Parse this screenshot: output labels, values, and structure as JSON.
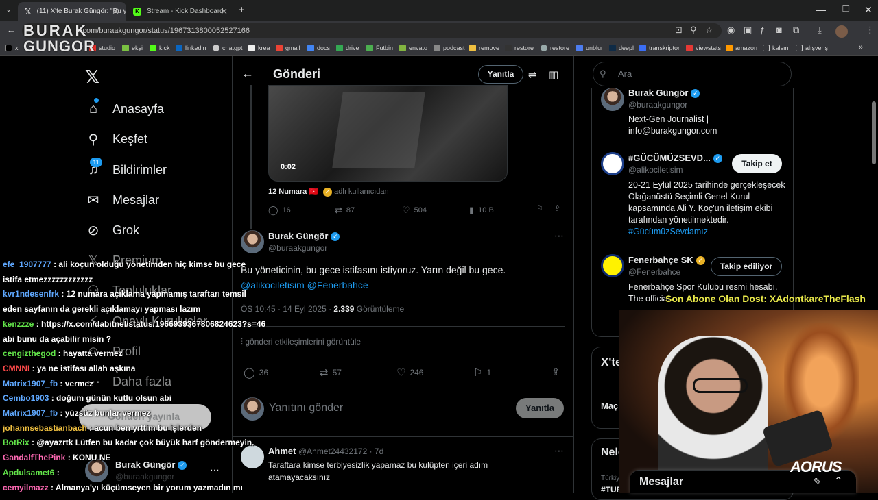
{
  "browser": {
    "tabs": [
      {
        "title": "(11) X'te Burak Güngör: \"Bu yön",
        "icon": "x-icon"
      },
      {
        "title": "Stream - Kick Dashboard",
        "icon": "kick-icon"
      }
    ],
    "url": "x.com/buraakgungor/status/1967313800052527166",
    "bookmarks": [
      "x",
      "studio",
      "ekşi",
      "kick",
      "linkedin",
      "chatgpt",
      "krea",
      "gmail",
      "docs",
      "drive",
      "Futbin",
      "envato",
      "podcast",
      "remove",
      "restore",
      "restore",
      "unblur",
      "deepl",
      "transkriptor",
      "viewstats",
      "amazon",
      "kalsın",
      "alışveriş"
    ]
  },
  "overlay_logo": {
    "line1": "BURAK",
    "line2": "GUNGOR"
  },
  "nav": {
    "items": [
      {
        "label": "Anasayfa",
        "icon": "home-icon"
      },
      {
        "label": "Keşfet",
        "icon": "search-icon"
      },
      {
        "label": "Bildirimler",
        "icon": "bell-icon"
      },
      {
        "label": "Mesajlar",
        "icon": "mail-icon"
      },
      {
        "label": "Grok",
        "icon": "grok-icon"
      },
      {
        "label": "Premium",
        "icon": "x-premium-icon"
      },
      {
        "label": "Topluluklar",
        "icon": "communities-icon"
      },
      {
        "label": "Onaylı Kuruluşlar",
        "icon": "verified-orgs-icon"
      },
      {
        "label": "Profil",
        "icon": "profile-icon"
      },
      {
        "label": "Daha fazla",
        "icon": "more-icon"
      }
    ],
    "notif_count": "11",
    "post_button": "Gönderi yayınla",
    "account": {
      "name": "Burak Güngör",
      "handle": "@buraakgungor"
    }
  },
  "post_header": {
    "title": "Gönderi",
    "reply_label": "Yanıtla"
  },
  "quoted": {
    "duration": "0:02",
    "user": "12 Numara 🇹🇷",
    "user_suffix": "adlı kullanıcıdan",
    "stats": {
      "replies": "16",
      "reposts": "87",
      "likes": "504",
      "views": "10 B"
    }
  },
  "tweet": {
    "name": "Burak Güngör",
    "handle": "@buraakgungor",
    "text": "Bu yöneticinin, bu gece istifasını istiyoruz. Yarın değil bu gece.",
    "mentions": "@alikociletisim @Fenerbahce",
    "time": "ÖS 10:45 · 14 Eyl 2025 · ",
    "views_count": "2.339",
    "views_label": " Görüntüleme",
    "engagement_link": "gönderi etkileşimlerini görüntüle",
    "stats": {
      "replies": "36",
      "reposts": "57",
      "likes": "246",
      "bookmarks": "1"
    }
  },
  "compose": {
    "placeholder": "Yanıtını gönder",
    "button": "Yanıtla"
  },
  "reply": {
    "name": "Ahmet",
    "handle": "@Ahmet24432172 · 7d",
    "text": "Taraftara kimse terbiyesizlik yapamaz bu kulüpten içeri adım atamayacaksınız"
  },
  "right": {
    "search_placeholder": "Ara",
    "accounts": [
      {
        "name": "Burak Güngör",
        "handle": "@buraakgungor",
        "bio": "Next-Gen Journalist | info@burakgungor.com",
        "button": ""
      },
      {
        "name": "#GÜCÜMÜZSEVD...",
        "handle": "@alikociletisim",
        "bio": "20-21 Eylül 2025 tarihinde gerçekleşecek Olağanüstü Seçimli Genel Kurul kapsamında Ali Y. Koç'un iletişim ekibi tarafından yönetilmektedir.",
        "bio_tag": "#GücümüzSevdamız",
        "button": "Takip et"
      },
      {
        "name": "Fenerbahçe SK",
        "handle": "@Fenerbahce",
        "bio": "Fenerbahçe Spor Kulübü resmi hesabı. The official",
        "button": "Takip ediliyor"
      }
    ],
    "box2_title": "X'te",
    "box2_item": "Maç",
    "box3_title": "Neler oluyor?",
    "box3_sub": "Türkiye t",
    "box3_tag": "#TURv",
    "messages_label": "Mesajlar"
  },
  "chat": [
    {
      "user": "efe_1907777",
      "msg": "ali koçun olduğu yönetimden hiç kimse bu gece istifa etmezzzzzzzzzzzz",
      "color": "#5fa8ff"
    },
    {
      "user": "kvr1ndesenfrk",
      "msg": "12 numara açıklama yapmamış taraftarı temsil eden sayfanın da gerekli açıklamayı yapması lazım",
      "color": "#5fa8ff"
    },
    {
      "user": "kenzzze",
      "msg": "https://x.com/dabitnel/status/1966939367806824623?s=46 abi bunu da açabilir misin ?",
      "color": "#63e64a"
    },
    {
      "user": "cengizthegod",
      "msg": "hayatta vermez",
      "color": "#63e64a"
    },
    {
      "user": "CMNNI",
      "msg": "ya ne istifası allah aşkına",
      "color": "#ff4a4a"
    },
    {
      "user": "Matrix1907_fb",
      "msg": "vermez",
      "color": "#5fa8ff"
    },
    {
      "user": "Cembo1903",
      "msg": "doğum günün kutlu olsun abi",
      "color": "#5fa8ff"
    },
    {
      "user": "Matrix1907_fb",
      "msg": "yüzsüz bunlar vermez",
      "color": "#5fa8ff"
    },
    {
      "user": "johannsebastianbach",
      "msg": "acun ben yrttim bu işlerden",
      "color": "#f0c040"
    },
    {
      "user": "BotRix",
      "msg": "@ayazrtk Lütfen bu kadar çok büyük harf göndermeyin.",
      "color": "#63e64a"
    },
    {
      "user": "GandalfThePink",
      "msg": "KONU NE",
      "color": "#ff69b4"
    },
    {
      "user": "Apdulsamet6",
      "msg": "",
      "color": "#63e64a"
    },
    {
      "user": "cemyilmazz",
      "msg": "Almanya'yı küçümseyen bir yorum yazmadın mı",
      "color": "#ff69b4"
    }
  ],
  "cam": {
    "alert": "Son Abone Olan Dost: XAdontkareTheFlash",
    "brand": "AORUS"
  },
  "colors": {
    "accent": "#1d9bf0",
    "bg": "#000000",
    "muted": "#71767b"
  }
}
